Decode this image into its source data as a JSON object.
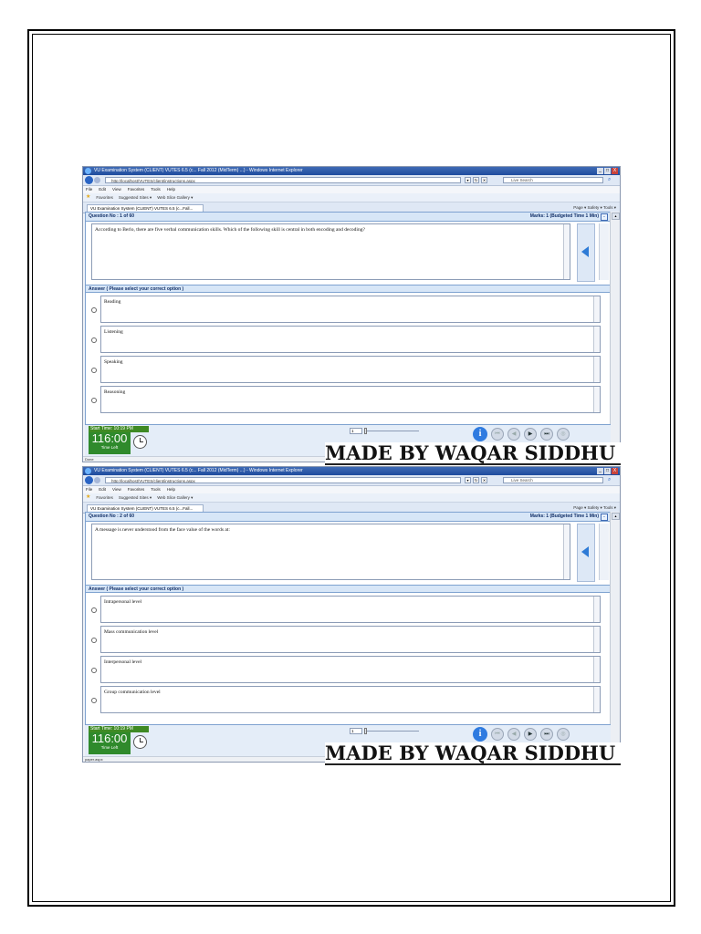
{
  "window": {
    "title": "VU Examination System (CLIENT) VUTES 6.5 (c... Fall 2012 (MidTerm) ...) - Windows Internet Explorer",
    "minimize": "_",
    "maximize": "□",
    "close": "X"
  },
  "address_bar": {
    "url": "http://localhost/VUTES/client/instructions.aspx",
    "search_placeholder": "Live Search"
  },
  "menu": [
    "File",
    "Edit",
    "View",
    "Favorites",
    "Tools",
    "Help"
  ],
  "favorites_bar": {
    "favorites": "Favorites",
    "suggested": "Suggested Sites ▾",
    "gallery": "Web Slice Gallery ▾"
  },
  "tab": {
    "label": "VU Examination System (CLIENT) VUTES 6.5 (c...Fall..."
  },
  "command_bar": "Page ▾  Safety ▾  Tools ▾",
  "exam": {
    "answer_header": "Answer ( Please select your correct option )",
    "start_time": "Start Time: 10:19 PM",
    "timer": "116:00",
    "timer_label": "Time Left",
    "page_value": "1",
    "info_label": "i",
    "first": "⏮",
    "prev": "◀",
    "next": "▶",
    "last": "⏭",
    "finish": "◎"
  },
  "screens": [
    {
      "question_no": "Question No : 1 of 60",
      "marks": "Marks: 1 (Budgeted Time 1 Min)",
      "question": "According to Berlo, there are five verbal communication skills. Which of the following skill is central in both encoding and decoding?",
      "options": [
        "Reading",
        "Listening",
        "Speaking",
        "Reasoning"
      ],
      "status": "Done"
    },
    {
      "question_no": "Question No : 2 of 60",
      "marks": "Marks: 1 (Budgeted Time 1 Min)",
      "question": "A message is never understood from the face value of the words at:",
      "options": [
        "Intrapersonal level",
        "Mass communication level",
        "Interpersonal level",
        "Group communication level"
      ],
      "status": "paper.aspx"
    }
  ],
  "watermark": "MADE BY WAQAR SIDDHU"
}
